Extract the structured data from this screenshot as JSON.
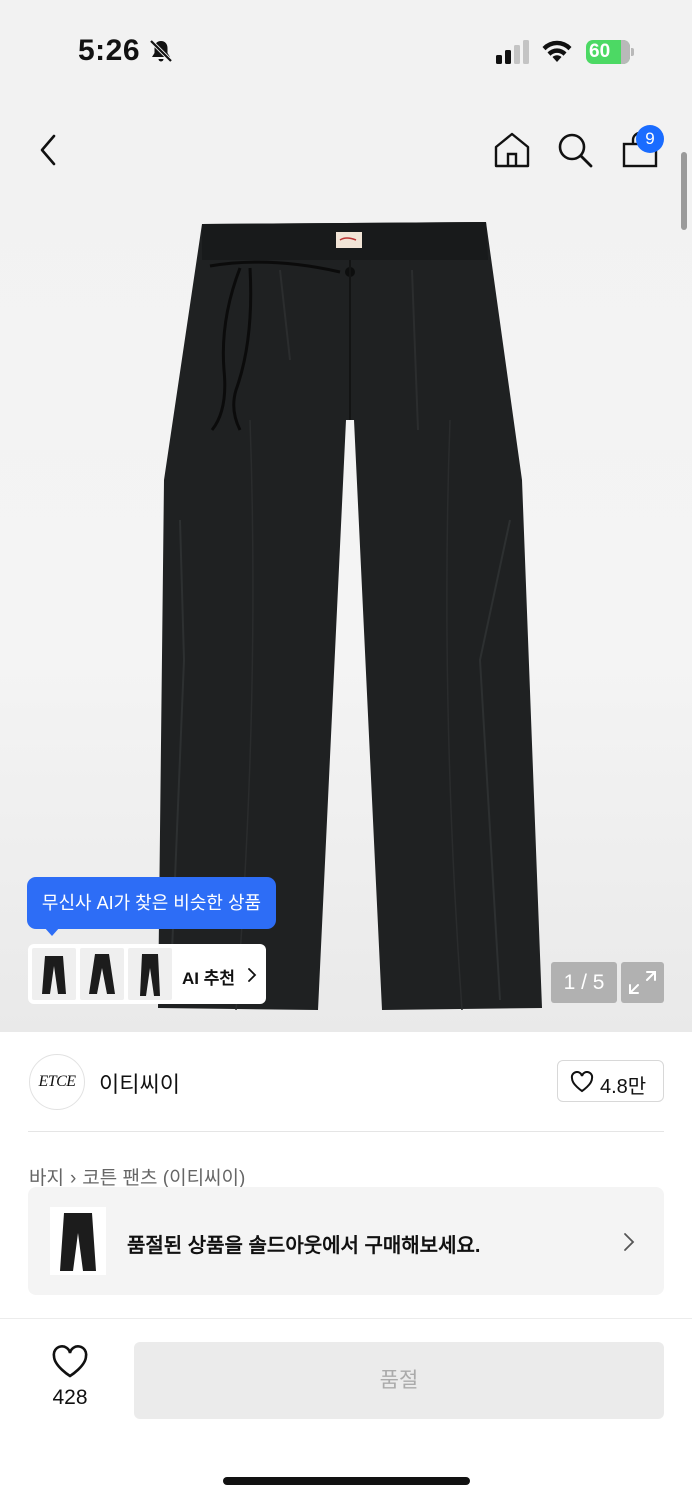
{
  "status_bar": {
    "time": "5:26",
    "battery": "60"
  },
  "header": {
    "cart_count": "9"
  },
  "gallery": {
    "ai_tooltip": "무신사 AI가 찾은 비슷한 상품",
    "ai_recommend_label": "AI 추천",
    "counter": "1 / 5"
  },
  "brand": {
    "logo_text": "ETCE",
    "name": "이티씨이",
    "likes": "4.8만"
  },
  "breadcrumb": {
    "category": "바지",
    "subcategory": "코튼 팬츠 (이티씨이)"
  },
  "soldout": {
    "message": "품절된 상품을 솔드아웃에서 구매해보세요."
  },
  "bottom_bar": {
    "wish_count": "428",
    "buy_label": "품절"
  },
  "colors": {
    "accent": "#2d6df6",
    "badge": "#1a6cff",
    "battery": "#4cd964"
  }
}
